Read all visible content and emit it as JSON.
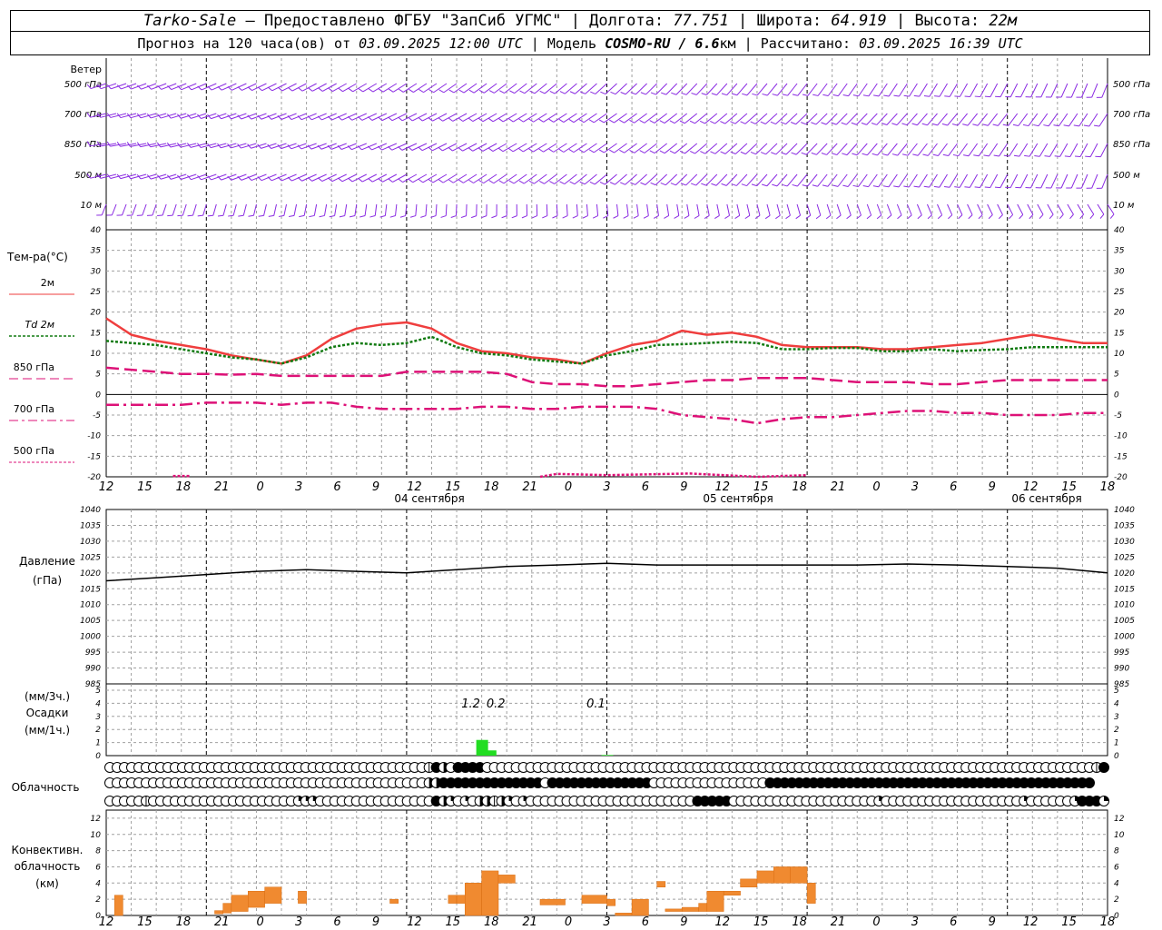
{
  "header": {
    "station": "Tarko-Sale",
    "provider": "Предоставлено ФГБУ \"ЗапСиб УГМС\"",
    "lon_label": "Долгота:",
    "lon_value": "77.751",
    "lat_label": "Широта:",
    "lat_value": "64.919",
    "alt_label": "Высота:",
    "alt_value": "22м",
    "forecast_prefix": "Прогноз на 120 часа(ов) от",
    "forecast_start": "03.09.2025 12:00 UTC",
    "model_label": "Модель",
    "model_name": "COSMO-RU / 6.6",
    "model_unit": "км",
    "calc_label": "Рассчитано:",
    "calc_time": "03.09.2025 16:39 UTC"
  },
  "colors": {
    "wind": "#8a2be2",
    "t2m": "#ef3e3e",
    "td2m": "#117a11",
    "t850": "#dd1177",
    "t700": "#dd1177",
    "t500": "#dd1177",
    "pressure": "#000000",
    "precip": "#22dd22",
    "convective": "#f08a30",
    "grid": "#a0a0a0"
  },
  "labels": {
    "wind": "Ветер",
    "wind_levels": [
      "500 гПа",
      "700 гПа",
      "850 гПа",
      "500 м",
      "10 м"
    ],
    "temp_title": "Тем-ра(°C)",
    "temp_legend": [
      "2м",
      "Td 2м",
      "850 гПа",
      "700 гПа",
      "500 гПа"
    ],
    "pressure": [
      "Давление",
      "(гПа)"
    ],
    "precip": [
      "(мм/3ч.)",
      "Осадки",
      "(мм/1ч.)"
    ],
    "cloud": "Облачность",
    "conv": [
      "Конвективн.",
      "облачность",
      "(км)"
    ]
  },
  "time_axis": {
    "ticks": [
      "12",
      "15",
      "18",
      "21",
      "0",
      "3",
      "6",
      "9",
      "12",
      "15",
      "18",
      "21",
      "0",
      "3",
      "6",
      "9",
      "12",
      "15",
      "18",
      "21",
      "0",
      "3",
      "6",
      "9",
      "12",
      "15",
      "18"
    ],
    "days": [
      "04 сентября",
      "05 сентября",
      "06 сентября"
    ]
  },
  "chart_data": [
    {
      "type": "line",
      "title": "Тем-ра(°C)",
      "x_hours": [
        0,
        3,
        6,
        9,
        12,
        15,
        18,
        21,
        24,
        27,
        30,
        33,
        36,
        39,
        42,
        45,
        48,
        51,
        54,
        57,
        60,
        63,
        66,
        69,
        72,
        75,
        78,
        81,
        84,
        87,
        90,
        93,
        96,
        99,
        102,
        105,
        108,
        111,
        114,
        117,
        120
      ],
      "ylim": [
        -20,
        40
      ],
      "yticks": [
        -20,
        -15,
        -10,
        -5,
        0,
        5,
        10,
        15,
        20,
        25,
        30,
        35,
        40
      ],
      "series": [
        {
          "name": "2м",
          "values": [
            18.5,
            14.5,
            13,
            12,
            11,
            9.5,
            8.5,
            7.5,
            9.5,
            13.5,
            16,
            17,
            17.5,
            16,
            12.5,
            10.5,
            10,
            9,
            8.5,
            7.5,
            10,
            12,
            13,
            15.5,
            14.5,
            15,
            14,
            12,
            11.5,
            11.5,
            11.5,
            11,
            11,
            11.5,
            12,
            12.5,
            13.5,
            14.5,
            13.5,
            12.5,
            12.5
          ]
        },
        {
          "name": "Td 2м",
          "values": [
            13,
            12.5,
            12,
            11,
            10,
            9,
            8.5,
            7.5,
            9,
            11.5,
            12.5,
            12,
            12.5,
            14,
            11.5,
            10,
            9.5,
            8.5,
            8,
            7.5,
            9.5,
            10.5,
            12,
            12.2,
            12.5,
            12.8,
            12.5,
            11,
            11,
            11.3,
            11.3,
            10.5,
            10.5,
            11,
            10.5,
            10.8,
            11,
            11.5,
            11.5,
            11.5,
            11.5
          ]
        },
        {
          "name": "850 гПа",
          "values": [
            6.5,
            6,
            5.5,
            5,
            5,
            4.8,
            5,
            4.5,
            4.5,
            4.5,
            4.5,
            4.5,
            5.5,
            5.5,
            5.5,
            5.5,
            5,
            3,
            2.5,
            2.5,
            2,
            2,
            2.5,
            3,
            3.5,
            3.5,
            4,
            4,
            4,
            3.5,
            3,
            3,
            3,
            2.5,
            2.5,
            3,
            3.5,
            3.5,
            3.5,
            3.5,
            3.5
          ]
        },
        {
          "name": "700 гПа",
          "values": [
            -2.5,
            -2.5,
            -2.5,
            -2.5,
            -2,
            -2,
            -2,
            -2.5,
            -2,
            -2,
            -3,
            -3.5,
            -3.5,
            -3.5,
            -3.5,
            -3,
            -3,
            -3.5,
            -3.5,
            -3,
            -3,
            -3,
            -3.5,
            -5,
            -5.5,
            -6,
            -7,
            -6,
            -5.5,
            -5.5,
            -5,
            -4.5,
            -4,
            -4,
            -4.5,
            -4.5,
            -5,
            -5,
            -5,
            -4.5,
            -4.5
          ]
        }
      ]
    },
    {
      "type": "line",
      "title": "Давление (гПа)",
      "x_hours": [
        0,
        6,
        12,
        18,
        24,
        30,
        36,
        42,
        48,
        54,
        60,
        66,
        72,
        78,
        84,
        90,
        96,
        102,
        108,
        114,
        120
      ],
      "ylim": [
        985,
        1040
      ],
      "yticks": [
        985,
        990,
        995,
        1000,
        1005,
        1010,
        1015,
        1020,
        1025,
        1030,
        1035,
        1040
      ],
      "series": [
        {
          "name": "Давление",
          "values": [
            1017.5,
            1018.5,
            1019.5,
            1020.5,
            1021,
            1020.5,
            1020,
            1021,
            1022,
            1022.5,
            1023,
            1022.5,
            1022.5,
            1022.5,
            1022.5,
            1022.5,
            1022.8,
            1022.5,
            1022,
            1021.5,
            1020
          ]
        }
      ]
    },
    {
      "type": "bar",
      "title": "Осадки",
      "ylim": [
        0,
        5
      ],
      "yticks": [
        0,
        1,
        2,
        3,
        4,
        5
      ],
      "labels_3h": [
        {
          "hour": 45,
          "text": "1.2"
        },
        {
          "hour": 48,
          "text": "0.2"
        },
        {
          "hour": 60,
          "text": "0.1"
        }
      ],
      "bars_1h": [
        {
          "hour": 45,
          "value": 1.2
        },
        {
          "hour": 46,
          "value": 0.4
        },
        {
          "hour": 60,
          "value": 0.05
        }
      ]
    },
    {
      "type": "table",
      "title": "Облачность",
      "rows": [
        "oooooooooooooooooooooooooooooooooooooooooooopDdoDDDDoooooooooooooooooooooooooooooooooooooooooooooooooooooooooooooooooooooooooooooooooooopD",
        "ooooooooooooooooooooooooooooooooooooooooooooddDDDDDDDDDDDDDDoDDDDDDDDDDDDDDooooooooooooooooDDDDDDDDDDDDDDDDDDDDDDDDDDDDDDDDDDDDDDDDDDDDD",
        "ooooopooooooooooooooooooooqqqooooooooooooooooDdqoqoddpdqoqoooooooooooooooooooooooDDDDDooooooooooooooooooooqoooooooooooooooooooqooooooqDDDq"
      ]
    },
    {
      "type": "bar",
      "title": "Конвективн. облачность (км)",
      "ylim": [
        0,
        13
      ],
      "yticks": [
        0,
        2,
        4,
        6,
        8,
        10,
        12
      ],
      "bars": [
        {
          "from": 1,
          "to": 2,
          "base": 0,
          "top": 2.5
        },
        {
          "from": 13,
          "to": 14,
          "base": 0.2,
          "top": 0.6
        },
        {
          "from": 14,
          "to": 15,
          "base": 0.3,
          "top": 1.5
        },
        {
          "from": 15,
          "to": 17,
          "base": 0.5,
          "top": 2.5
        },
        {
          "from": 17,
          "to": 19,
          "base": 1,
          "top": 3
        },
        {
          "from": 19,
          "to": 21,
          "base": 1.5,
          "top": 3.5
        },
        {
          "from": 23,
          "to": 24,
          "base": 1.5,
          "top": 3
        },
        {
          "from": 34,
          "to": 35,
          "base": 1.5,
          "top": 2
        },
        {
          "from": 41,
          "to": 42,
          "base": 1.5,
          "top": 2.5
        },
        {
          "from": 42,
          "to": 43,
          "base": 1.5,
          "top": 2.5
        },
        {
          "from": 43,
          "to": 45,
          "base": 0,
          "top": 4
        },
        {
          "from": 45,
          "to": 47,
          "base": 0,
          "top": 5.5
        },
        {
          "from": 47,
          "to": 49,
          "base": 4,
          "top": 5
        },
        {
          "from": 52,
          "to": 55,
          "base": 1.3,
          "top": 2
        },
        {
          "from": 57,
          "to": 60,
          "base": 1.5,
          "top": 2.5
        },
        {
          "from": 60,
          "to": 61,
          "base": 1.2,
          "top": 2
        },
        {
          "from": 61,
          "to": 63,
          "base": 0,
          "top": 0.3
        },
        {
          "from": 63,
          "to": 65,
          "base": 0,
          "top": 2
        },
        {
          "from": 66,
          "to": 67,
          "base": 3.5,
          "top": 4.2
        },
        {
          "from": 67,
          "to": 69,
          "base": 0.5,
          "top": 0.8
        },
        {
          "from": 69,
          "to": 71,
          "base": 0.5,
          "top": 1
        },
        {
          "from": 71,
          "to": 72,
          "base": 0.5,
          "top": 1.5
        },
        {
          "from": 72,
          "to": 74,
          "base": 0.5,
          "top": 3
        },
        {
          "from": 74,
          "to": 76,
          "base": 2.5,
          "top": 3
        },
        {
          "from": 76,
          "to": 78,
          "base": 3.5,
          "top": 4.5
        },
        {
          "from": 78,
          "to": 80,
          "base": 4,
          "top": 5.5
        },
        {
          "from": 80,
          "to": 82,
          "base": 4,
          "top": 6
        },
        {
          "from": 82,
          "to": 84,
          "base": 4,
          "top": 6
        },
        {
          "from": 84,
          "to": 85,
          "base": 1.5,
          "top": 4
        }
      ]
    }
  ]
}
